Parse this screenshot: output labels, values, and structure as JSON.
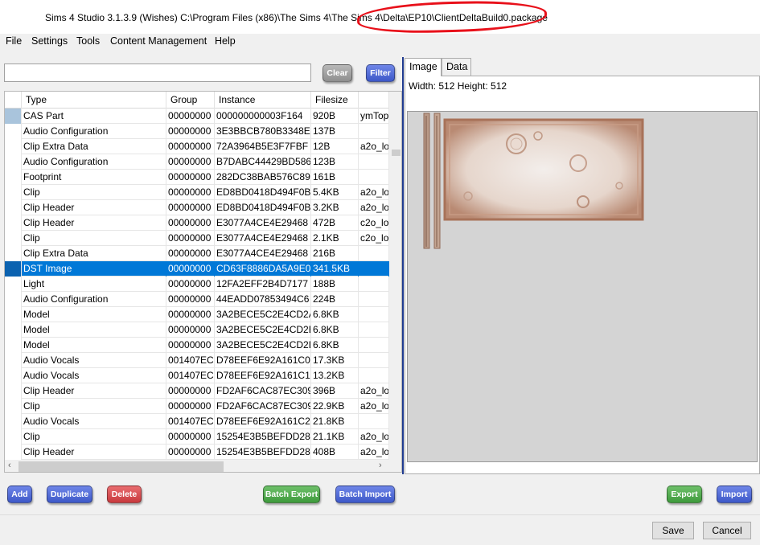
{
  "window": {
    "title": "Sims 4 Studio 3.1.3.9 (Wishes)  C:\\Program Files (x86)\\The Sims 4\\The Sims 4\\Delta\\EP10\\ClientDeltaBuild0.package",
    "annotation_color": "#e8101a"
  },
  "menu": [
    "File",
    "Settings",
    "Tools",
    "Content Management",
    "Help"
  ],
  "search": {
    "value": "",
    "placeholder": ""
  },
  "toolbar": {
    "clear_label": "Clear",
    "filter_label": "Filter"
  },
  "grid": {
    "columns": [
      "Type",
      "Group",
      "Instance",
      "Filesize",
      ""
    ],
    "rows": [
      {
        "type": "CAS Part",
        "group": "00000000",
        "instance": "000000000003F164",
        "filesize": "920B",
        "extra": "ymTop"
      },
      {
        "type": "Audio Configuration",
        "group": "00000000",
        "instance": "3E3BBCB780B3348E",
        "filesize": "137B",
        "extra": ""
      },
      {
        "type": "Clip Extra Data",
        "group": "00000000",
        "instance": "72A3964B5E3F7FBF",
        "filesize": "12B",
        "extra": "a2o_lo"
      },
      {
        "type": "Audio Configuration",
        "group": "00000000",
        "instance": "B7DABC44429BD586",
        "filesize": "123B",
        "extra": ""
      },
      {
        "type": "Footprint",
        "group": "00000000",
        "instance": "282DC38BAB576C89",
        "filesize": "161B",
        "extra": ""
      },
      {
        "type": "Clip",
        "group": "00000000",
        "instance": "ED8BD0418D494F0B",
        "filesize": "5.4KB",
        "extra": "a2o_lo"
      },
      {
        "type": "Clip Header",
        "group": "00000000",
        "instance": "ED8BD0418D494F0B",
        "filesize": "3.2KB",
        "extra": "a2o_lo"
      },
      {
        "type": "Clip Header",
        "group": "00000000",
        "instance": "E3077A4CE4E29468",
        "filesize": "472B",
        "extra": "c2o_lo"
      },
      {
        "type": "Clip",
        "group": "00000000",
        "instance": "E3077A4CE4E29468",
        "filesize": "2.1KB",
        "extra": "c2o_lo"
      },
      {
        "type": "Clip Extra Data",
        "group": "00000000",
        "instance": "E3077A4CE4E29468",
        "filesize": "216B",
        "extra": ""
      },
      {
        "type": "DST Image",
        "group": "00000000",
        "instance": "CD63F8886DA5A9E0",
        "filesize": "341.5KB",
        "extra": ""
      },
      {
        "type": "Light",
        "group": "00000000",
        "instance": "12FA2EFF2B4D7177",
        "filesize": "188B",
        "extra": ""
      },
      {
        "type": "Audio Configuration",
        "group": "00000000",
        "instance": "44EADD07853494C6",
        "filesize": "224B",
        "extra": ""
      },
      {
        "type": "Model",
        "group": "00000000",
        "instance": "3A2BECE5C2E4CD2A",
        "filesize": "6.8KB",
        "extra": ""
      },
      {
        "type": "Model",
        "group": "00000000",
        "instance": "3A2BECE5C2E4CD2B",
        "filesize": "6.8KB",
        "extra": ""
      },
      {
        "type": "Model",
        "group": "00000000",
        "instance": "3A2BECE5C2E4CD2D",
        "filesize": "6.8KB",
        "extra": ""
      },
      {
        "type": "Audio Vocals",
        "group": "001407EC",
        "instance": "D78EEF6E92A161C0",
        "filesize": "17.3KB",
        "extra": ""
      },
      {
        "type": "Audio Vocals",
        "group": "001407EC",
        "instance": "D78EEF6E92A161C1",
        "filesize": "13.2KB",
        "extra": ""
      },
      {
        "type": "Clip Header",
        "group": "00000000",
        "instance": "FD2AF6CAC87EC309",
        "filesize": "396B",
        "extra": "a2o_lo"
      },
      {
        "type": "Clip",
        "group": "00000000",
        "instance": "FD2AF6CAC87EC309",
        "filesize": "22.9KB",
        "extra": "a2o_lo"
      },
      {
        "type": "Audio Vocals",
        "group": "001407EC",
        "instance": "D78EEF6E92A161C2",
        "filesize": "21.8KB",
        "extra": ""
      },
      {
        "type": "Clip",
        "group": "00000000",
        "instance": "15254E3B5BEFDD28",
        "filesize": "21.1KB",
        "extra": "a2o_lo"
      },
      {
        "type": "Clip Header",
        "group": "00000000",
        "instance": "15254E3B5BEFDD28",
        "filesize": "408B",
        "extra": "a2o_lo"
      }
    ],
    "selected_type": "DST Image",
    "selected_color": "#0078d7"
  },
  "scrollbar_icons": {
    "left": "chevron-left-icon",
    "right": "chevron-right-icon"
  },
  "tabs": [
    {
      "label": "Image",
      "active": true
    },
    {
      "label": "Data",
      "active": false
    }
  ],
  "image_panel": {
    "dimensions": "Width: 512 Height: 512"
  },
  "actions": {
    "add": "Add",
    "duplicate": "Duplicate",
    "delete": "Delete",
    "batch_export": "Batch Export",
    "batch_import": "Batch Import",
    "export": "Export",
    "import": "Import"
  },
  "dialog": {
    "save": "Save",
    "cancel": "Cancel"
  }
}
